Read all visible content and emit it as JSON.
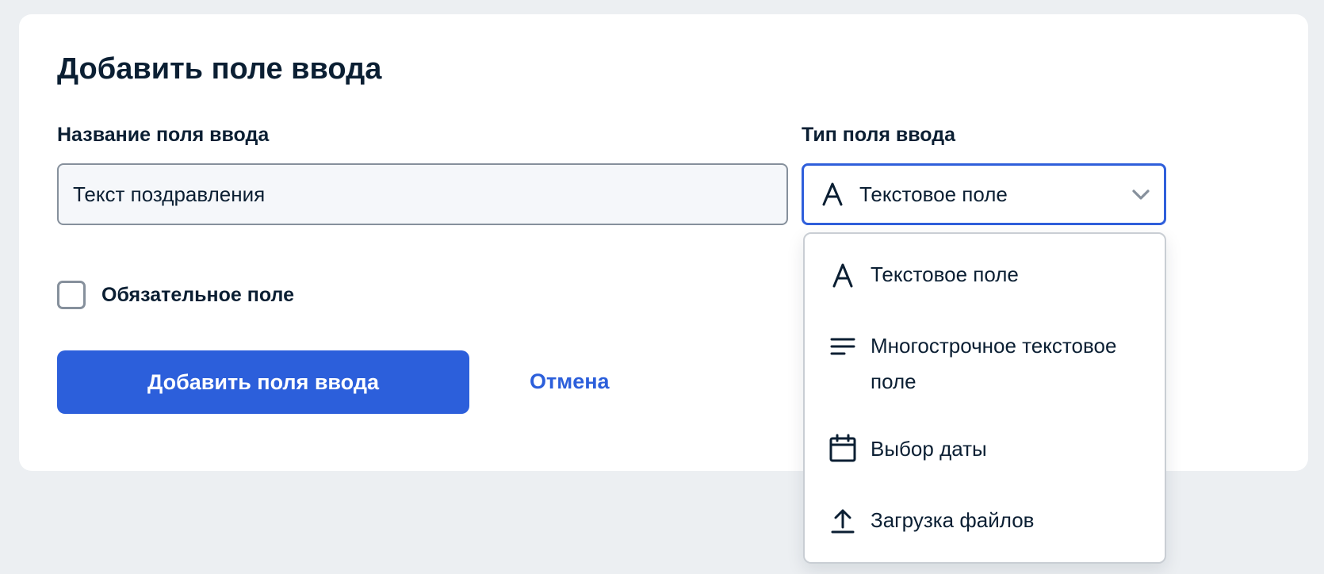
{
  "form": {
    "title": "Добавить поле ввода",
    "name_label": "Название поля ввода",
    "name_value": "Текст поздравления",
    "type_label": "Тип поля ввода",
    "type_value": "Текстовое поле",
    "type_value_icon": "letter-a-icon",
    "required_label": "Обязательное поле",
    "required_checked": false,
    "submit_label": "Добавить поля ввода",
    "cancel_label": "Отмена"
  },
  "dropdown": {
    "options": [
      {
        "label": "Текстовое поле",
        "icon": "letter-a-icon"
      },
      {
        "label": "Многострочное текстовое поле",
        "icon": "multiline-text-icon"
      },
      {
        "label": "Выбор даты",
        "icon": "calendar-icon"
      },
      {
        "label": "Загрузка файлов",
        "icon": "upload-icon"
      }
    ]
  },
  "colors": {
    "background": "#eceff2",
    "card": "#ffffff",
    "text": "#0b1f33",
    "accent": "#2c5fdb",
    "border": "#86909c"
  }
}
